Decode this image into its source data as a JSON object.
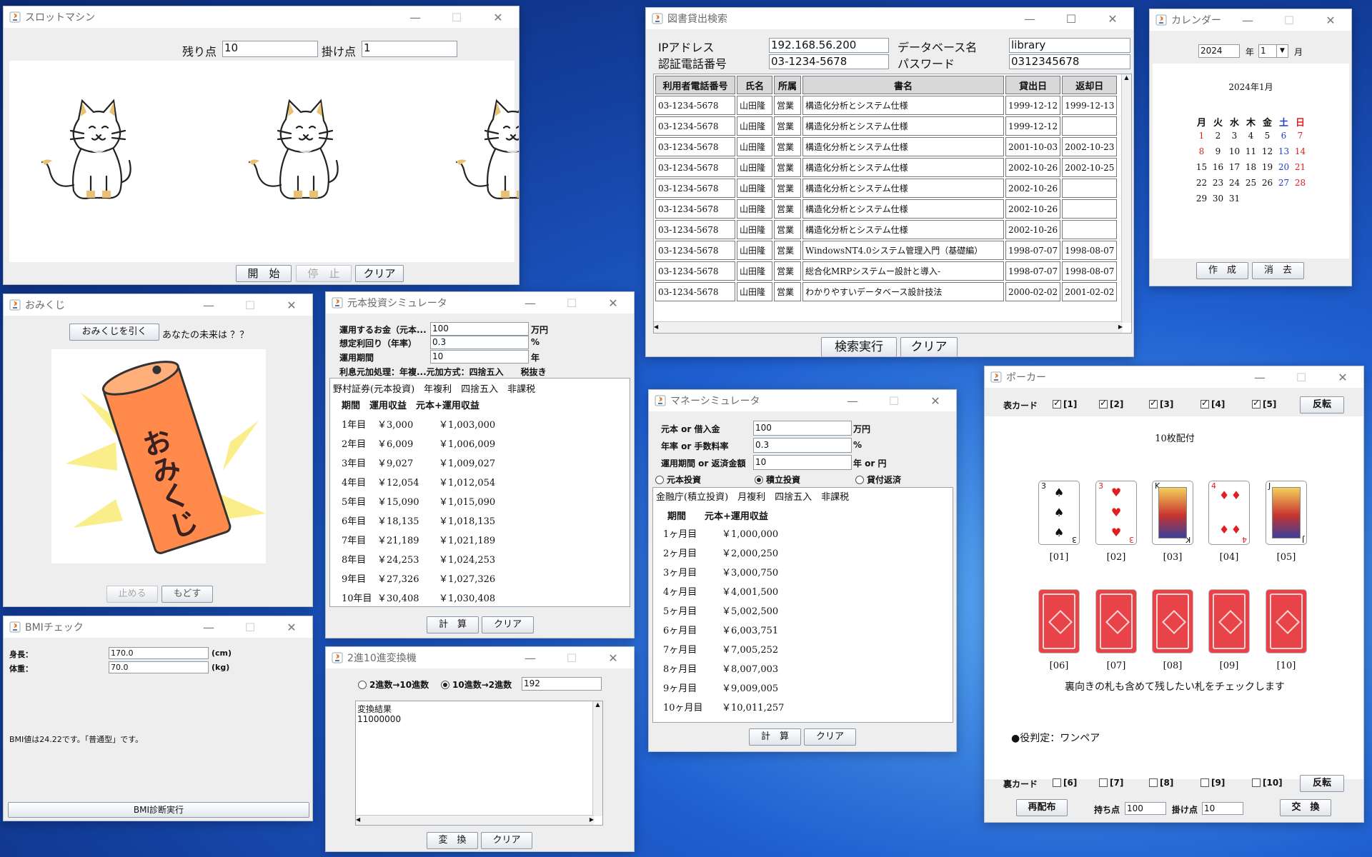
{
  "slot": {
    "title": "スロットマシン",
    "remaining_label": "残り点",
    "remaining_value": "10",
    "bet_label": "掛け点",
    "bet_value": "1",
    "start_button": "開　始",
    "stop_button": "停　止",
    "clear_button": "クリア"
  },
  "library": {
    "title": "図書貸出検索",
    "ip_label": "IPアドレス",
    "ip_value": "192.168.56.200",
    "db_label": "データベース名",
    "db_value": "library",
    "phone_label": "認証電話番号",
    "phone_value": "03-1234-5678",
    "pw_label": "パスワード",
    "pw_value": "0312345678",
    "columns": [
      "利用者電話番号",
      "氏名",
      "所属",
      "書名",
      "貸出日",
      "返却日"
    ],
    "rows": [
      [
        "03-1234-5678",
        "山田隆",
        "営業",
        "構造化分析とシステム仕様",
        "1999-12-12",
        "1999-12-13"
      ],
      [
        "03-1234-5678",
        "山田隆",
        "営業",
        "構造化分析とシステム仕様",
        "1999-12-12",
        ""
      ],
      [
        "03-1234-5678",
        "山田隆",
        "営業",
        "構造化分析とシステム仕様",
        "2001-10-03",
        "2002-10-23"
      ],
      [
        "03-1234-5678",
        "山田隆",
        "営業",
        "構造化分析とシステム仕様",
        "2002-10-26",
        "2002-10-25"
      ],
      [
        "03-1234-5678",
        "山田隆",
        "営業",
        "構造化分析とシステム仕様",
        "2002-10-26",
        ""
      ],
      [
        "03-1234-5678",
        "山田隆",
        "営業",
        "構造化分析とシステム仕様",
        "2002-10-26",
        ""
      ],
      [
        "03-1234-5678",
        "山田隆",
        "営業",
        "構造化分析とシステム仕様",
        "2002-10-26",
        ""
      ],
      [
        "03-1234-5678",
        "山田隆",
        "営業",
        "WindowsNT4.0システム管理入門（基礎編）",
        "1998-07-07",
        "1998-08-07"
      ],
      [
        "03-1234-5678",
        "山田隆",
        "営業",
        "総合化MRPシステムー設計と導入-",
        "1998-07-07",
        "1998-08-07"
      ],
      [
        "03-1234-5678",
        "山田隆",
        "営業",
        "わかりやすいデータベース設計技法",
        "2000-02-02",
        "2001-02-02"
      ]
    ],
    "search_button": "検索実行",
    "clear_button": "クリア"
  },
  "calendar": {
    "title": "カレンダー",
    "year_value": "2024",
    "year_label": "年",
    "month_value": "1",
    "month_label": "月",
    "heading": "2024年1月",
    "weekdays": [
      "月",
      "火",
      "水",
      "木",
      "金",
      "土",
      "日"
    ],
    "weeks": [
      [
        "1",
        "2",
        "3",
        "4",
        "5",
        "6",
        "7"
      ],
      [
        "8",
        "9",
        "10",
        "11",
        "12",
        "13",
        "14"
      ],
      [
        "15",
        "16",
        "17",
        "18",
        "19",
        "20",
        "21"
      ],
      [
        "22",
        "23",
        "24",
        "25",
        "26",
        "27",
        "28"
      ],
      [
        "29",
        "30",
        "31",
        "",
        "",
        "",
        ""
      ]
    ],
    "create_button": "作　成",
    "erase_button": "消　去",
    "colors": {
      "saturday": "#1a3fd0",
      "sunday": "#e02020",
      "holiday": "#e02020"
    }
  },
  "omikuji": {
    "title": "おみくじ",
    "draw_button": "おみくじを引く",
    "future_text": "あなたの未来は ？？",
    "image_text": "おみくじ",
    "stop_button": "止める",
    "back_button": "もどす"
  },
  "invest": {
    "title": "元本投資シミュレータ",
    "amount_label": "運用するお金（元本...",
    "amount_value": "100",
    "amount_unit": "万円",
    "rate_label": "想定利回り（年率）",
    "rate_value": "0.3",
    "rate_unit": "%",
    "period_label": "運用期間",
    "period_value": "10",
    "period_unit": "年",
    "note": "利息元加処理：年複...元加方式：四捨五入　　税抜き",
    "result_header": "野村証券(元本投資)　年複利　四捨五入　非課税",
    "result_cols": "期間　運用収益　元本+運用収益",
    "result_rows": [
      [
        "1年目",
        "￥3,000",
        "￥1,003,000"
      ],
      [
        "2年目",
        "￥6,009",
        "￥1,006,009"
      ],
      [
        "3年目",
        "￥9,027",
        "￥1,009,027"
      ],
      [
        "4年目",
        "￥12,054",
        "￥1,012,054"
      ],
      [
        "5年目",
        "￥15,090",
        "￥1,015,090"
      ],
      [
        "6年目",
        "￥18,135",
        "￥1,018,135"
      ],
      [
        "7年目",
        "￥21,189",
        "￥1,021,189"
      ],
      [
        "8年目",
        "￥24,253",
        "￥1,024,253"
      ],
      [
        "9年目",
        "￥27,326",
        "￥1,027,326"
      ],
      [
        "10年目",
        "￥30,408",
        "￥1,030,408"
      ]
    ],
    "calc_button": "計　算",
    "clear_button": "クリア"
  },
  "money": {
    "title": "マネーシミュレータ",
    "principal_label": "元本 or 借入金",
    "principal_value": "100",
    "principal_unit": "万円",
    "rate_label": "年率 or 手数料率",
    "rate_value": "0.3",
    "rate_unit": "%",
    "period_label": "運用期間 or 返済金額",
    "period_value": "10",
    "period_unit": "年 or 円",
    "radio1": "元本投資",
    "radio2": "積立投資",
    "radio3": "貸付返済",
    "result_header": "金融庁(積立投資)　月複利　四捨五入　非課税",
    "result_cols": "期間　　元本+運用収益",
    "result_rows": [
      [
        "1ヶ月目",
        "￥1,000,000"
      ],
      [
        "2ヶ月目",
        "￥2,000,250"
      ],
      [
        "3ヶ月目",
        "￥3,000,750"
      ],
      [
        "4ヶ月目",
        "￥4,001,500"
      ],
      [
        "5ヶ月目",
        "￥5,002,500"
      ],
      [
        "6ヶ月目",
        "￥6,003,751"
      ],
      [
        "7ヶ月目",
        "￥7,005,252"
      ],
      [
        "8ヶ月目",
        "￥8,007,003"
      ],
      [
        "9ヶ月目",
        "￥9,009,005"
      ],
      [
        "10ヶ月目",
        "￥10,011,257"
      ]
    ],
    "calc_button": "計　算",
    "clear_button": "クリア"
  },
  "bmi": {
    "title": "BMIチェック",
    "height_label": "身長：",
    "height_value": "170.0",
    "height_unit": "(cm)",
    "weight_label": "体重：",
    "weight_value": "70.0",
    "weight_unit": "(kg)",
    "result": "BMI値は24.22です。「普通型」です。",
    "run_button": "BMI診断実行"
  },
  "converter": {
    "title": "2進10進変換機",
    "radio_b2d": "2進数→10進数",
    "radio_d2b": "10進数→2進数",
    "input_value": "192",
    "result_title": "変換結果",
    "result_value": "11000000",
    "convert_button": "変　換",
    "clear_button": "クリア"
  },
  "poker": {
    "title": "ポーカー",
    "face_label": "表カード",
    "face_checks": [
      "[1]",
      "[2]",
      "[3]",
      "[4]",
      "[5]"
    ],
    "flip_button": "反転",
    "dealt_text": "10枚配付",
    "top_cards": [
      {
        "rank": "3",
        "suit": "♠",
        "label": "[01]",
        "red": false
      },
      {
        "rank": "3",
        "suit": "♥",
        "label": "[02]",
        "red": true
      },
      {
        "rank": "K",
        "suit": "♣",
        "label": "[03]",
        "red": false
      },
      {
        "rank": "4",
        "suit": "♦",
        "label": "[04]",
        "red": true
      },
      {
        "rank": "J",
        "suit": "♣",
        "label": "[05]",
        "red": false
      }
    ],
    "bottom_labels": [
      "[06]",
      "[07]",
      "[08]",
      "[09]",
      "[10]"
    ],
    "instruction": "裏向きの札も含めて残したい札をチェックします",
    "hand_result": "●役判定：ワンペア",
    "back_label": "裏カード",
    "back_checks": [
      "[6]",
      "[7]",
      "[8]",
      "[9]",
      "[10]"
    ],
    "flip_button2": "反転",
    "redeal_button": "再配布",
    "points_label": "持ち点",
    "points_value": "100",
    "bet_label": "掛け点",
    "bet_value": "10",
    "exchange_button": "交　換"
  }
}
